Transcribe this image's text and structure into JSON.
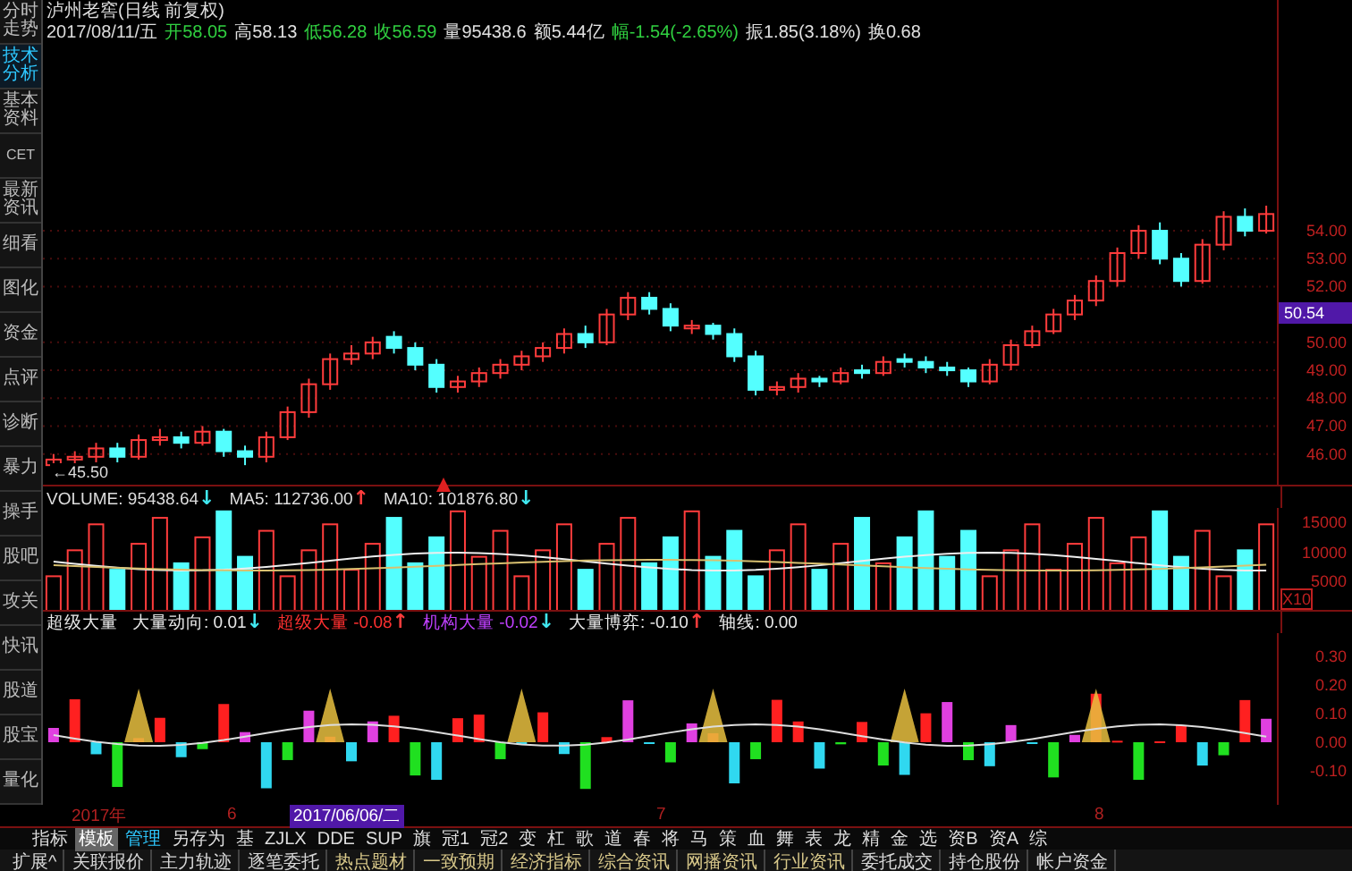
{
  "sidebar_tabs": [
    {
      "label": "分时走势",
      "selected": false
    },
    {
      "label": "技术分析",
      "selected": true
    },
    {
      "label": "基本资料",
      "selected": false
    },
    {
      "label": "CET",
      "selected": false
    },
    {
      "label": "最新资讯",
      "selected": false
    },
    {
      "label": "细看",
      "selected": false
    },
    {
      "label": "图化",
      "selected": false
    },
    {
      "label": "资金",
      "selected": false
    },
    {
      "label": "点评",
      "selected": false
    },
    {
      "label": "诊断",
      "selected": false
    },
    {
      "label": "暴力",
      "selected": false
    },
    {
      "label": "操手",
      "selected": false
    },
    {
      "label": "股吧",
      "selected": false
    },
    {
      "label": "攻关",
      "selected": false
    },
    {
      "label": "快讯",
      "selected": false
    },
    {
      "label": "股道",
      "selected": false
    },
    {
      "label": "股宝",
      "selected": false
    },
    {
      "label": "量化",
      "selected": false
    }
  ],
  "header": {
    "title": "泸州老窖(日线 前复权)",
    "date": "2017/08/11/五",
    "quotes": [
      {
        "text": "开58.05",
        "color": "#30d040"
      },
      {
        "text": "高58.13",
        "color": "#e0e0e0"
      },
      {
        "text": "低56.28",
        "color": "#30d040"
      },
      {
        "text": "收56.59",
        "color": "#30d040"
      },
      {
        "text": "量95438.6",
        "color": "#e0e0e0"
      },
      {
        "text": "额5.44亿",
        "color": "#e0e0e0"
      },
      {
        "text": "幅-1.54(-2.65%)",
        "color": "#30d040"
      },
      {
        "text": "振1.85(3.18%)",
        "color": "#e0e0e0"
      },
      {
        "text": "换0.68",
        "color": "#e0e0e0"
      }
    ]
  },
  "price_chart": {
    "chart_data": {
      "type": "candlestick",
      "grid": true,
      "ylim": [
        44.9,
        62.27
      ],
      "categories": [
        null,
        null,
        null,
        null,
        null,
        null,
        null,
        null,
        null,
        null,
        null,
        null,
        null,
        null,
        null,
        null,
        null,
        null,
        null,
        null,
        null,
        null,
        null,
        null,
        null,
        null,
        null,
        null,
        null,
        null,
        null,
        null,
        null,
        null,
        null,
        null,
        null,
        null,
        null,
        null,
        null,
        null,
        null,
        null,
        null,
        null,
        null,
        null,
        null,
        null,
        null,
        null,
        null,
        null,
        null,
        null,
        null,
        null
      ],
      "ohlc": [
        [
          45.6,
          46.0,
          45.5,
          45.8
        ],
        [
          45.8,
          46.1,
          45.6,
          45.9
        ],
        [
          45.9,
          46.4,
          45.7,
          46.2
        ],
        [
          46.2,
          46.4,
          45.7,
          45.9
        ],
        [
          45.9,
          46.7,
          45.8,
          46.5
        ],
        [
          46.5,
          46.9,
          46.3,
          46.6
        ],
        [
          46.6,
          46.8,
          46.2,
          46.4
        ],
        [
          46.4,
          47.0,
          46.3,
          46.8
        ],
        [
          46.8,
          46.9,
          45.9,
          46.1
        ],
        [
          46.1,
          46.3,
          45.6,
          45.9
        ],
        [
          45.9,
          46.8,
          45.7,
          46.6
        ],
        [
          46.6,
          47.7,
          46.5,
          47.5
        ],
        [
          47.5,
          48.7,
          47.3,
          48.5
        ],
        [
          48.5,
          49.6,
          48.3,
          49.4
        ],
        [
          49.4,
          49.9,
          49.2,
          49.6
        ],
        [
          49.6,
          50.2,
          49.4,
          50.0
        ],
        [
          50.2,
          50.4,
          49.6,
          49.8
        ],
        [
          49.8,
          50.0,
          49.0,
          49.2
        ],
        [
          49.2,
          49.4,
          48.2,
          48.4
        ],
        [
          48.4,
          48.8,
          48.2,
          48.6
        ],
        [
          48.6,
          49.1,
          48.4,
          48.9
        ],
        [
          48.9,
          49.4,
          48.7,
          49.2
        ],
        [
          49.2,
          49.7,
          49.0,
          49.5
        ],
        [
          49.5,
          50.0,
          49.3,
          49.8
        ],
        [
          49.8,
          50.5,
          49.6,
          50.3
        ],
        [
          50.3,
          50.6,
          49.8,
          50.0
        ],
        [
          50.0,
          51.2,
          49.9,
          51.0
        ],
        [
          51.0,
          51.8,
          50.8,
          51.6
        ],
        [
          51.6,
          51.8,
          51.0,
          51.2
        ],
        [
          51.2,
          51.4,
          50.4,
          50.6
        ],
        [
          50.5,
          50.8,
          50.3,
          50.6
        ],
        [
          50.6,
          50.7,
          50.1,
          50.3
        ],
        [
          50.3,
          50.5,
          49.3,
          49.5
        ],
        [
          49.5,
          49.7,
          48.1,
          48.3
        ],
        [
          48.3,
          48.6,
          48.1,
          48.4
        ],
        [
          48.4,
          48.9,
          48.2,
          48.7
        ],
        [
          48.7,
          48.8,
          48.4,
          48.6
        ],
        [
          48.6,
          49.1,
          48.5,
          48.9
        ],
        [
          49.0,
          49.2,
          48.7,
          48.9
        ],
        [
          48.9,
          49.5,
          48.8,
          49.3
        ],
        [
          49.4,
          49.6,
          49.1,
          49.3
        ],
        [
          49.3,
          49.5,
          48.9,
          49.1
        ],
        [
          49.1,
          49.3,
          48.8,
          49.0
        ],
        [
          49.0,
          49.1,
          48.4,
          48.6
        ],
        [
          48.6,
          49.4,
          48.5,
          49.2
        ],
        [
          49.2,
          50.1,
          49.0,
          49.9
        ],
        [
          49.9,
          50.6,
          49.8,
          50.4
        ],
        [
          50.4,
          51.2,
          50.3,
          51.0
        ],
        [
          51.0,
          51.7,
          50.8,
          51.5
        ],
        [
          51.5,
          52.4,
          51.3,
          52.2
        ],
        [
          52.2,
          53.4,
          52.0,
          53.2
        ],
        [
          53.2,
          54.2,
          53.0,
          54.0
        ],
        [
          54.0,
          54.3,
          52.8,
          53.0
        ],
        [
          53.0,
          53.2,
          52.0,
          52.2
        ],
        [
          52.2,
          53.7,
          52.1,
          53.5
        ],
        [
          53.5,
          54.7,
          53.3,
          54.5
        ],
        [
          54.5,
          54.8,
          53.8,
          54.0
        ],
        [
          54.0,
          54.9,
          53.9,
          54.6
        ]
      ],
      "yticks": [
        {
          "value": 54,
          "label": "54.00"
        },
        {
          "value": 53,
          "label": "53.00"
        },
        {
          "value": 52,
          "label": "52.00"
        },
        {
          "value": 50,
          "label": "50.00"
        },
        {
          "value": 49,
          "label": "49.00"
        },
        {
          "value": 48,
          "label": "48.00"
        },
        {
          "value": 47,
          "label": "47.00"
        },
        {
          "value": 46,
          "label": "46.00"
        }
      ]
    },
    "current": "50.54",
    "low_marker": "←45.50"
  },
  "volume": {
    "legend": [
      {
        "label": "VOLUME:",
        "value": "95438.64",
        "arrow": "↓",
        "color": "#40e8f0"
      },
      {
        "label": "MA5:",
        "value": "112736.00",
        "arrow": "↑",
        "color": "#ff3c3c"
      },
      {
        "label": "MA10:",
        "value": "101876.80",
        "arrow": "↓",
        "color": "#40e8f0"
      }
    ],
    "axis": [
      "15000",
      "10000",
      "5000"
    ],
    "unit": "X10"
  },
  "indicator": {
    "legend": [
      {
        "label": "超级大量",
        "color": "#e8e8e8"
      },
      {
        "label": "大量动向:",
        "value": "0.01",
        "arrow": {
          "text": "↓",
          "color": "#40e8f0"
        },
        "color": "#e8e8e8"
      },
      {
        "label": "超级大量",
        "value": "-0.08",
        "arrow": {
          "text": "↑",
          "color": "#ff3c3c"
        },
        "color": "#ff3030"
      },
      {
        "label": "机构大量",
        "value": "-0.02",
        "arrow": {
          "text": "↓",
          "color": "#40e8f0"
        },
        "color": "#c040ff"
      },
      {
        "label": "大量博弈:",
        "value": "-0.10",
        "arrow": {
          "text": "↑",
          "color": "#ff3c3c"
        },
        "color": "#e8e8e8"
      },
      {
        "label": "轴线:",
        "value": "0.00",
        "color": "#e8e8e8"
      }
    ],
    "axis": [
      "0.30",
      "0.20",
      "0.10",
      "0.00",
      "-0.10"
    ]
  },
  "date_axis": [
    {
      "text": "2017年",
      "highlighted": false
    },
    {
      "text": "6",
      "highlighted": false
    },
    {
      "text": "2017/06/06/二",
      "highlighted": true
    },
    {
      "text": "7",
      "highlighted": false
    },
    {
      "text": "8",
      "highlighted": false
    }
  ],
  "toolbar": [
    {
      "label": "指标",
      "selected": false,
      "accent": false
    },
    {
      "label": "模板",
      "selected": true,
      "accent": false
    },
    {
      "label": "管理",
      "selected": false,
      "accent": true
    },
    {
      "label": "另存为",
      "selected": false,
      "accent": false
    },
    {
      "label": "基",
      "selected": false,
      "accent": false
    },
    {
      "label": "ZJLX",
      "selected": false,
      "accent": false
    },
    {
      "label": "DDE",
      "selected": false,
      "accent": false
    },
    {
      "label": "SUP",
      "selected": false,
      "accent": false
    },
    {
      "label": "旗",
      "selected": false,
      "accent": false
    },
    {
      "label": "冠1",
      "selected": false,
      "accent": false
    },
    {
      "label": "冠2",
      "selected": false,
      "accent": false
    },
    {
      "label": "变",
      "selected": false,
      "accent": false
    },
    {
      "label": "杠",
      "selected": false,
      "accent": false
    },
    {
      "label": "歌",
      "selected": false,
      "accent": false
    },
    {
      "label": "道",
      "selected": false,
      "accent": false
    },
    {
      "label": "春",
      "selected": false,
      "accent": false
    },
    {
      "label": "将",
      "selected": false,
      "accent": false
    },
    {
      "label": "马",
      "selected": false,
      "accent": false
    },
    {
      "label": "策",
      "selected": false,
      "accent": false
    },
    {
      "label": "血",
      "selected": false,
      "accent": false
    },
    {
      "label": "舞",
      "selected": false,
      "accent": false
    },
    {
      "label": "表",
      "selected": false,
      "accent": false
    },
    {
      "label": "龙",
      "selected": false,
      "accent": false
    },
    {
      "label": "精",
      "selected": false,
      "accent": false
    },
    {
      "label": "金",
      "selected": false,
      "accent": false
    },
    {
      "label": "选",
      "selected": false,
      "accent": false
    },
    {
      "label": "资B",
      "selected": false,
      "accent": false
    },
    {
      "label": "资A",
      "selected": false,
      "accent": false
    },
    {
      "label": "综",
      "selected": false,
      "accent": false
    }
  ],
  "info_tabs": [
    {
      "label": "扩展^",
      "color": "#d8d8d8"
    },
    {
      "label": "关联报价",
      "color": "#d8d8d8"
    },
    {
      "label": "主力轨迹",
      "color": "#d8d8d8"
    },
    {
      "label": "逐笔委托",
      "color": "#d8d8d8"
    },
    {
      "label": "热点题材",
      "color": "#d8c88a"
    },
    {
      "label": "一致预期",
      "color": "#d8c88a"
    },
    {
      "label": "经济指标",
      "color": "#d8c88a"
    },
    {
      "label": "综合资讯",
      "color": "#d8c88a"
    },
    {
      "label": "网播资讯",
      "color": "#d8c88a"
    },
    {
      "label": "行业资讯",
      "color": "#d8c88a"
    },
    {
      "label": "委托成交",
      "color": "#d8d8d8"
    },
    {
      "label": "持仓股份",
      "color": "#d8d8d8"
    },
    {
      "label": "帐户资金",
      "color": "#d8d8d8"
    }
  ]
}
